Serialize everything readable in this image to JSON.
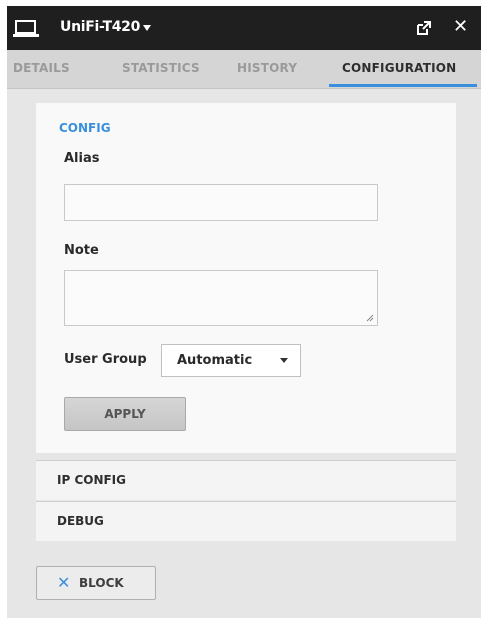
{
  "window": {
    "device_name": "UniFi-T420",
    "device_icon": "laptop-icon",
    "popout_icon": "popout-icon",
    "close_icon": "close-icon",
    "close_glyph": "✕"
  },
  "tabs": [
    {
      "label": "DETAILS",
      "active": false
    },
    {
      "label": "STATISTICS",
      "active": false
    },
    {
      "label": "HISTORY",
      "active": false
    },
    {
      "label": "CONFIGURATION",
      "active": true
    }
  ],
  "colors": {
    "accent": "#3a8fdc",
    "titlebar": "#1f1f1f"
  },
  "config": {
    "heading": "CONFIG",
    "alias_label": "Alias",
    "alias_value": "",
    "note_label": "Note",
    "note_value": "",
    "user_group_label": "User Group",
    "user_group_value": "Automatic",
    "apply_label": "APPLY"
  },
  "sections": [
    {
      "label": "IP CONFIG"
    },
    {
      "label": "DEBUG"
    }
  ],
  "block": {
    "icon_glyph": "✕",
    "label": "BLOCK"
  }
}
